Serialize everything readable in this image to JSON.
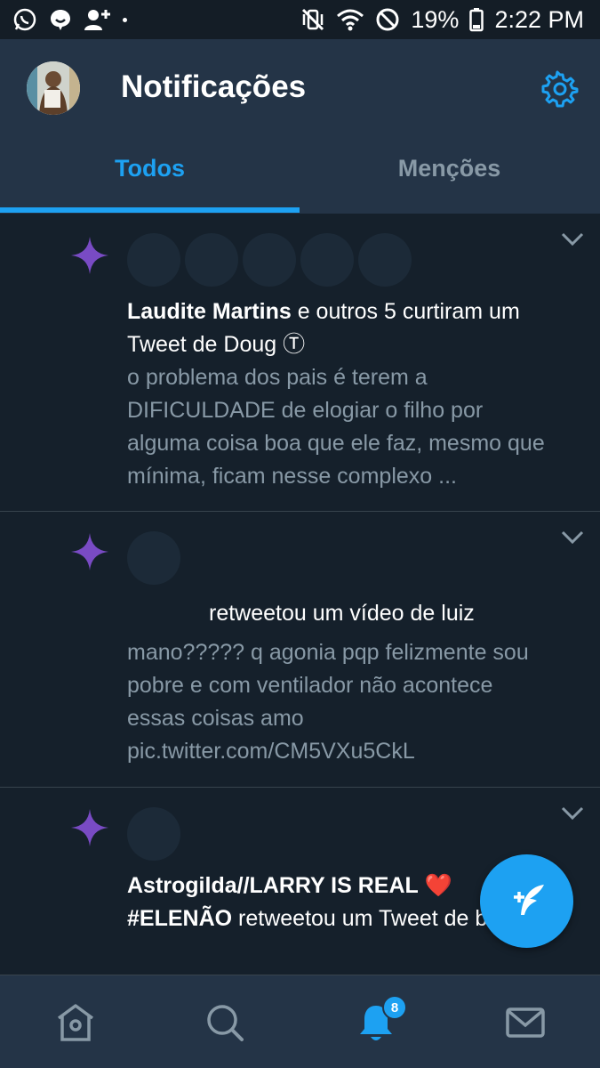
{
  "status_bar": {
    "battery": "19%",
    "time": "2:22 PM"
  },
  "header": {
    "title": "Notificações",
    "tabs": [
      {
        "label": "Todos",
        "active": true
      },
      {
        "label": "Menções",
        "active": false
      }
    ]
  },
  "notifications": [
    {
      "type": "like",
      "actor": "Laudite Martins",
      "action": " e outros 5 curtiram um Tweet de Doug Ⓣ",
      "avatar_count": 5,
      "tweet_text": "o problema dos pais é terem a DIFICULDADE de elogiar o filho por alguma coisa boa que ele faz, mesmo que mínima, ficam nesse complexo ..."
    },
    {
      "type": "retweet",
      "actor": "",
      "action": "retweetou um vídeo de luiz",
      "avatar_count": 1,
      "tweet_text": "mano????? q agonia pqp felizmente sou pobre e com ventilador não acontece essas coisas amo pic.twitter.com/CM5VXu5CkL"
    },
    {
      "type": "retweet",
      "actor": "Astrogilda//LARRY IS REAL",
      "actor_emoji": "❤️",
      "actor_line2": "#ELENÃO",
      "action": " retweetou um Tweet de bruno",
      "avatar_count": 1
    }
  ],
  "bottom_nav": {
    "items": [
      "home-icon",
      "search-icon",
      "notifications-icon",
      "messages-icon"
    ],
    "active": "notifications-icon",
    "notification_badge": "8"
  },
  "colors": {
    "background": "#15202b",
    "header": "#243447",
    "accent": "#1da1f2",
    "secondary_text": "#8899a6",
    "sparkle": "#794bc4"
  }
}
